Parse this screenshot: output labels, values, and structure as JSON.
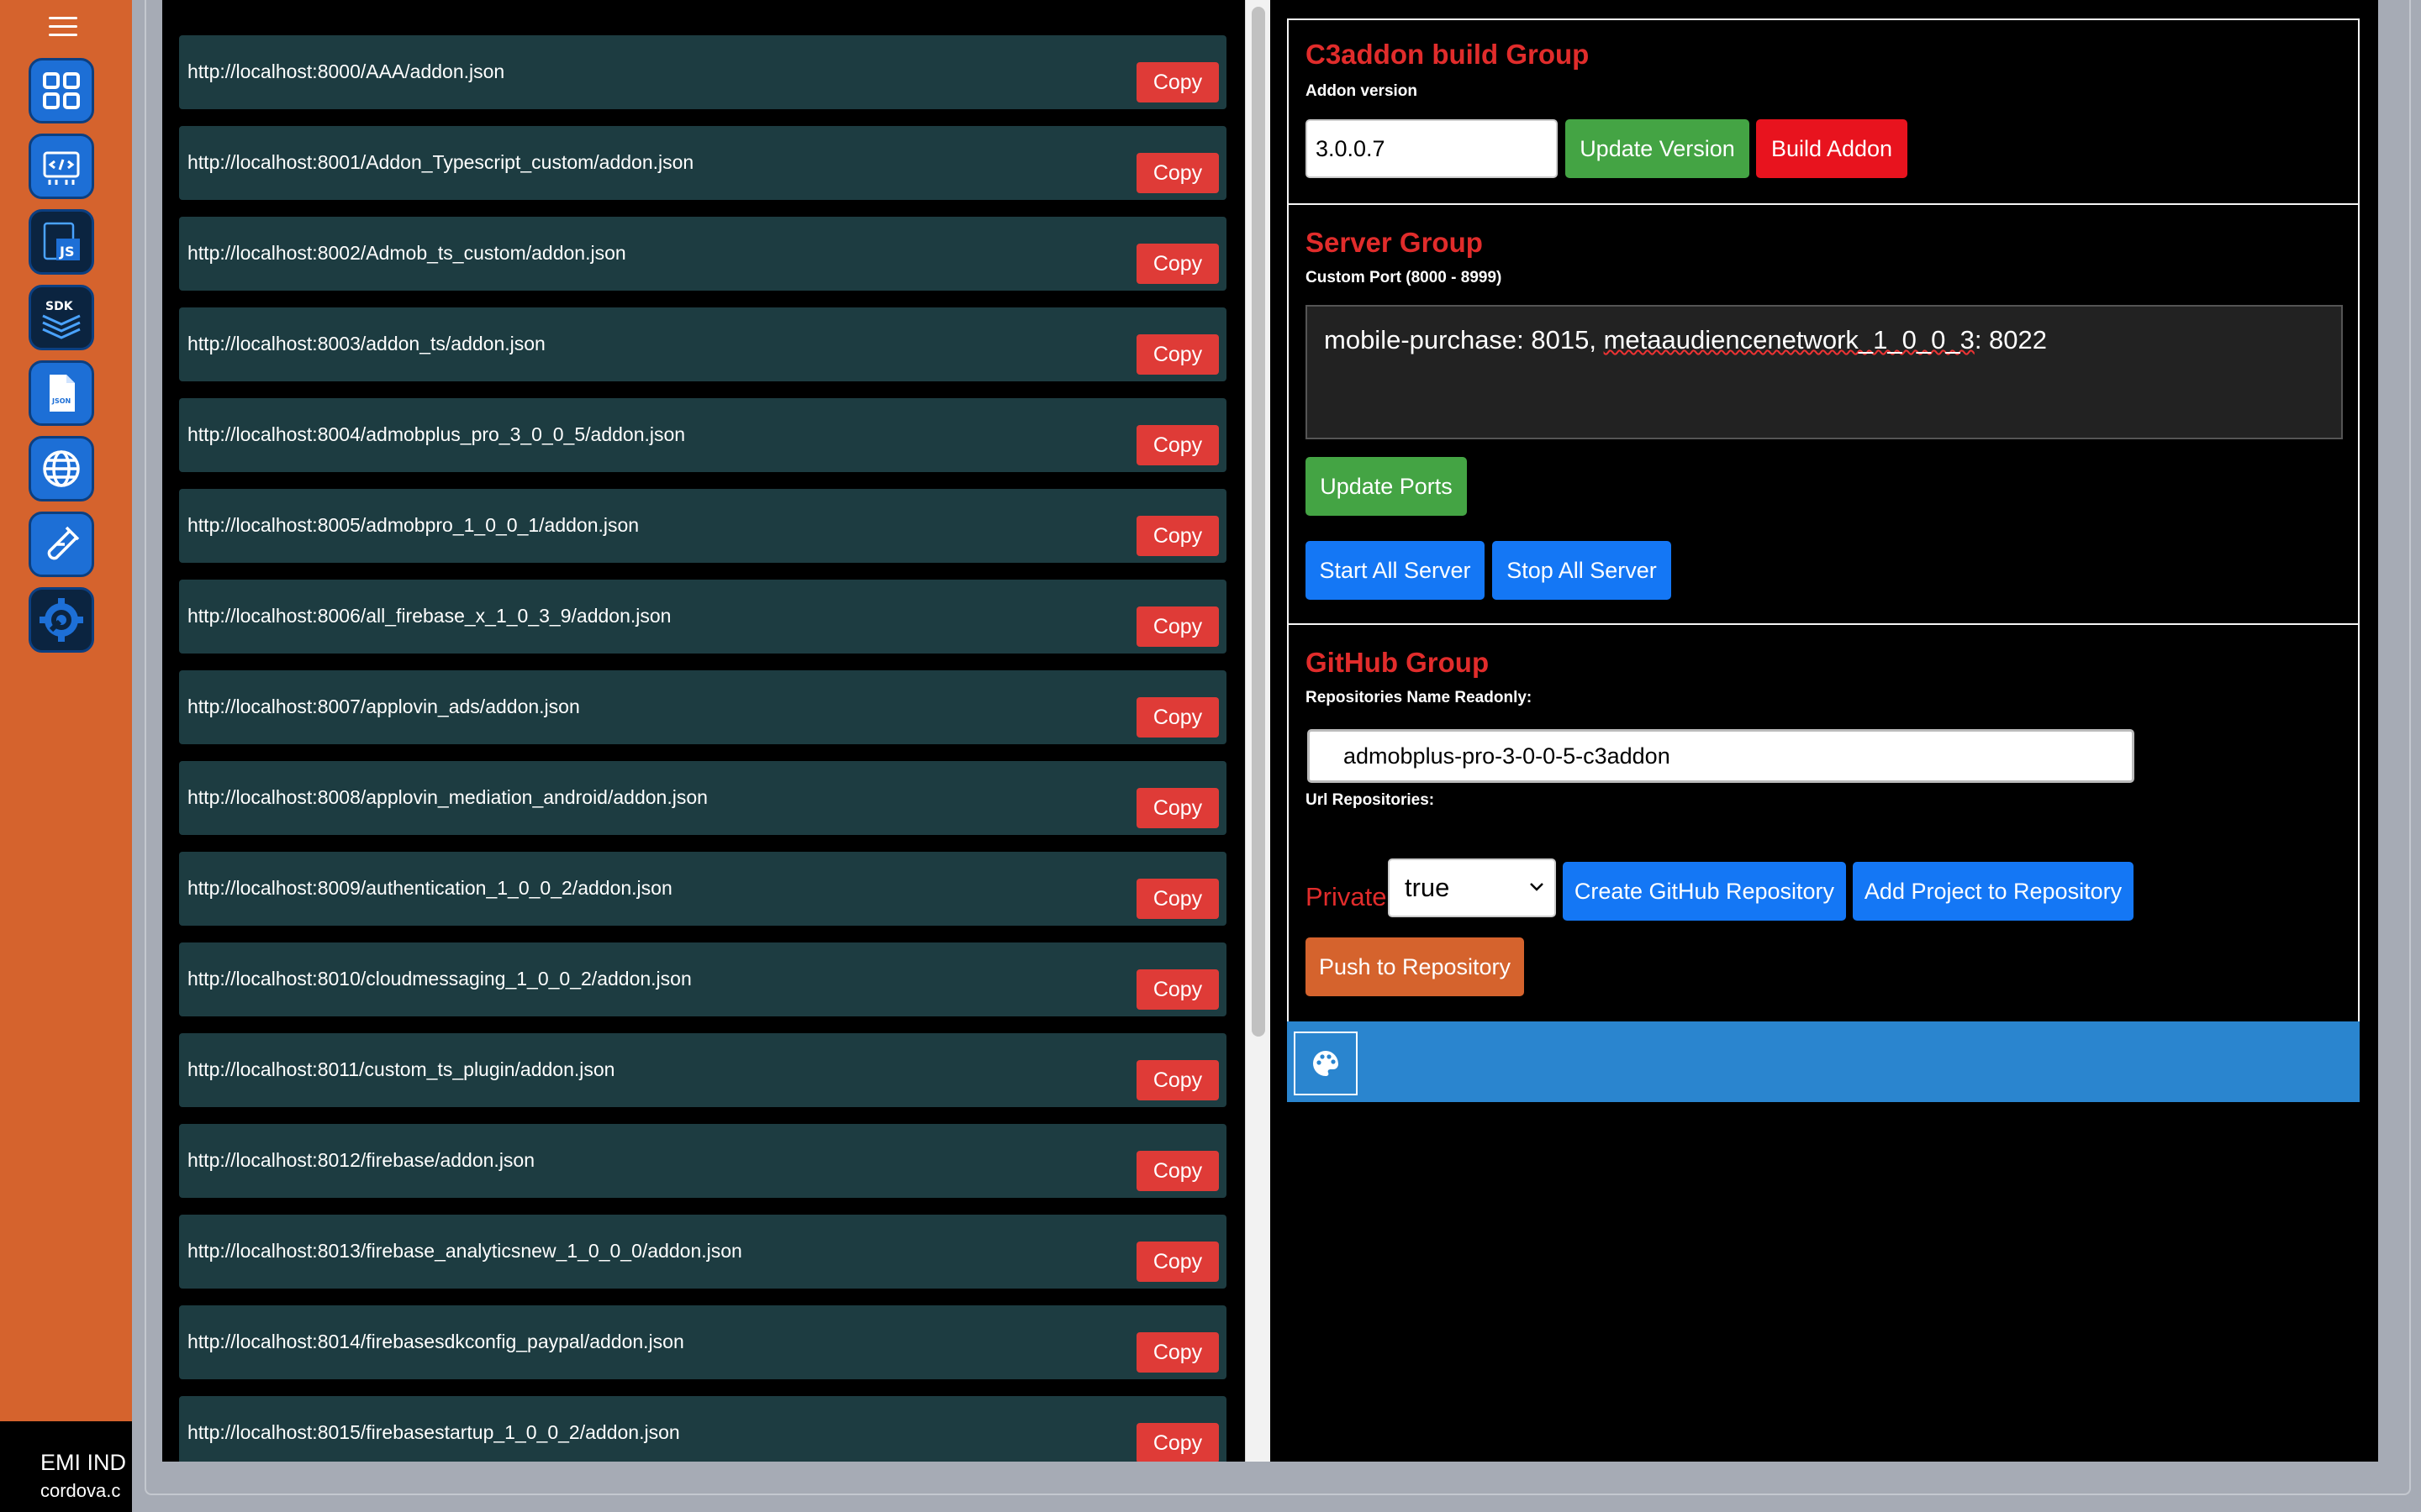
{
  "sidebar": {
    "icons": [
      {
        "name": "dashboard-grid-icon"
      },
      {
        "name": "code-editor-icon"
      },
      {
        "name": "js-file-icon"
      },
      {
        "name": "sdk-layers-icon"
      },
      {
        "name": "json-file-icon"
      },
      {
        "name": "globe-icon"
      },
      {
        "name": "test-tube-icon"
      },
      {
        "name": "settings-wrench-icon"
      }
    ],
    "brand_title": "EMI IND",
    "brand_sub": "cordova.c"
  },
  "url_list": {
    "copy_label": "Copy",
    "items": [
      "http://localhost:8000/AAA/addon.json",
      "http://localhost:8001/Addon_Typescript_custom/addon.json",
      "http://localhost:8002/Admob_ts_custom/addon.json",
      "http://localhost:8003/addon_ts/addon.json",
      "http://localhost:8004/admobplus_pro_3_0_0_5/addon.json",
      "http://localhost:8005/admobpro_1_0_0_1/addon.json",
      "http://localhost:8006/all_firebase_x_1_0_3_9/addon.json",
      "http://localhost:8007/applovin_ads/addon.json",
      "http://localhost:8008/applovin_mediation_android/addon.json",
      "http://localhost:8009/authentication_1_0_0_2/addon.json",
      "http://localhost:8010/cloudmessaging_1_0_0_2/addon.json",
      "http://localhost:8011/custom_ts_plugin/addon.json",
      "http://localhost:8012/firebase/addon.json",
      "http://localhost:8013/firebase_analyticsnew_1_0_0_0/addon.json",
      "http://localhost:8014/firebasesdkconfig_paypal/addon.json",
      "http://localhost:8015/firebasestartup_1_0_0_2/addon.json"
    ]
  },
  "build_group": {
    "title": "C3addon build Group",
    "version_label": "Addon version",
    "version_value": "3.0.0.7",
    "update_version_label": "Update Version",
    "build_addon_label": "Build Addon"
  },
  "server_group": {
    "title": "Server Group",
    "port_label": "Custom Port (8000 - 8999)",
    "ports_text_before": "mobile-purchase: 8015, ",
    "ports_text_misspelled": "metaaudiencenetwork_1_0_0_3",
    "ports_text_after": ": 8022",
    "update_ports_label": "Update Ports",
    "start_all_label": "Start All Server",
    "stop_all_label": "Stop All Server"
  },
  "github_group": {
    "title": "GitHub Group",
    "repo_name_label": "Repositories Name Readonly:",
    "repo_name_value": "admobplus-pro-3-0-0-5-c3addon",
    "url_label": "Url Repositories:",
    "private_label": "Private:",
    "private_value": "true",
    "create_repo_label": "Create GitHub Repository",
    "add_project_label": "Add Project to Repository",
    "push_label": "Push to Repository"
  },
  "toolbar": {
    "palette_icon": "palette-icon"
  },
  "colors": {
    "sidebar": "#d5632d",
    "row_bg": "#1d3c41",
    "copy_button": "#df3b37",
    "title_red": "#e12c2b",
    "green_button": "#44a444",
    "blue_button": "#1477f5",
    "toolbar_blue": "#2a85cf"
  }
}
